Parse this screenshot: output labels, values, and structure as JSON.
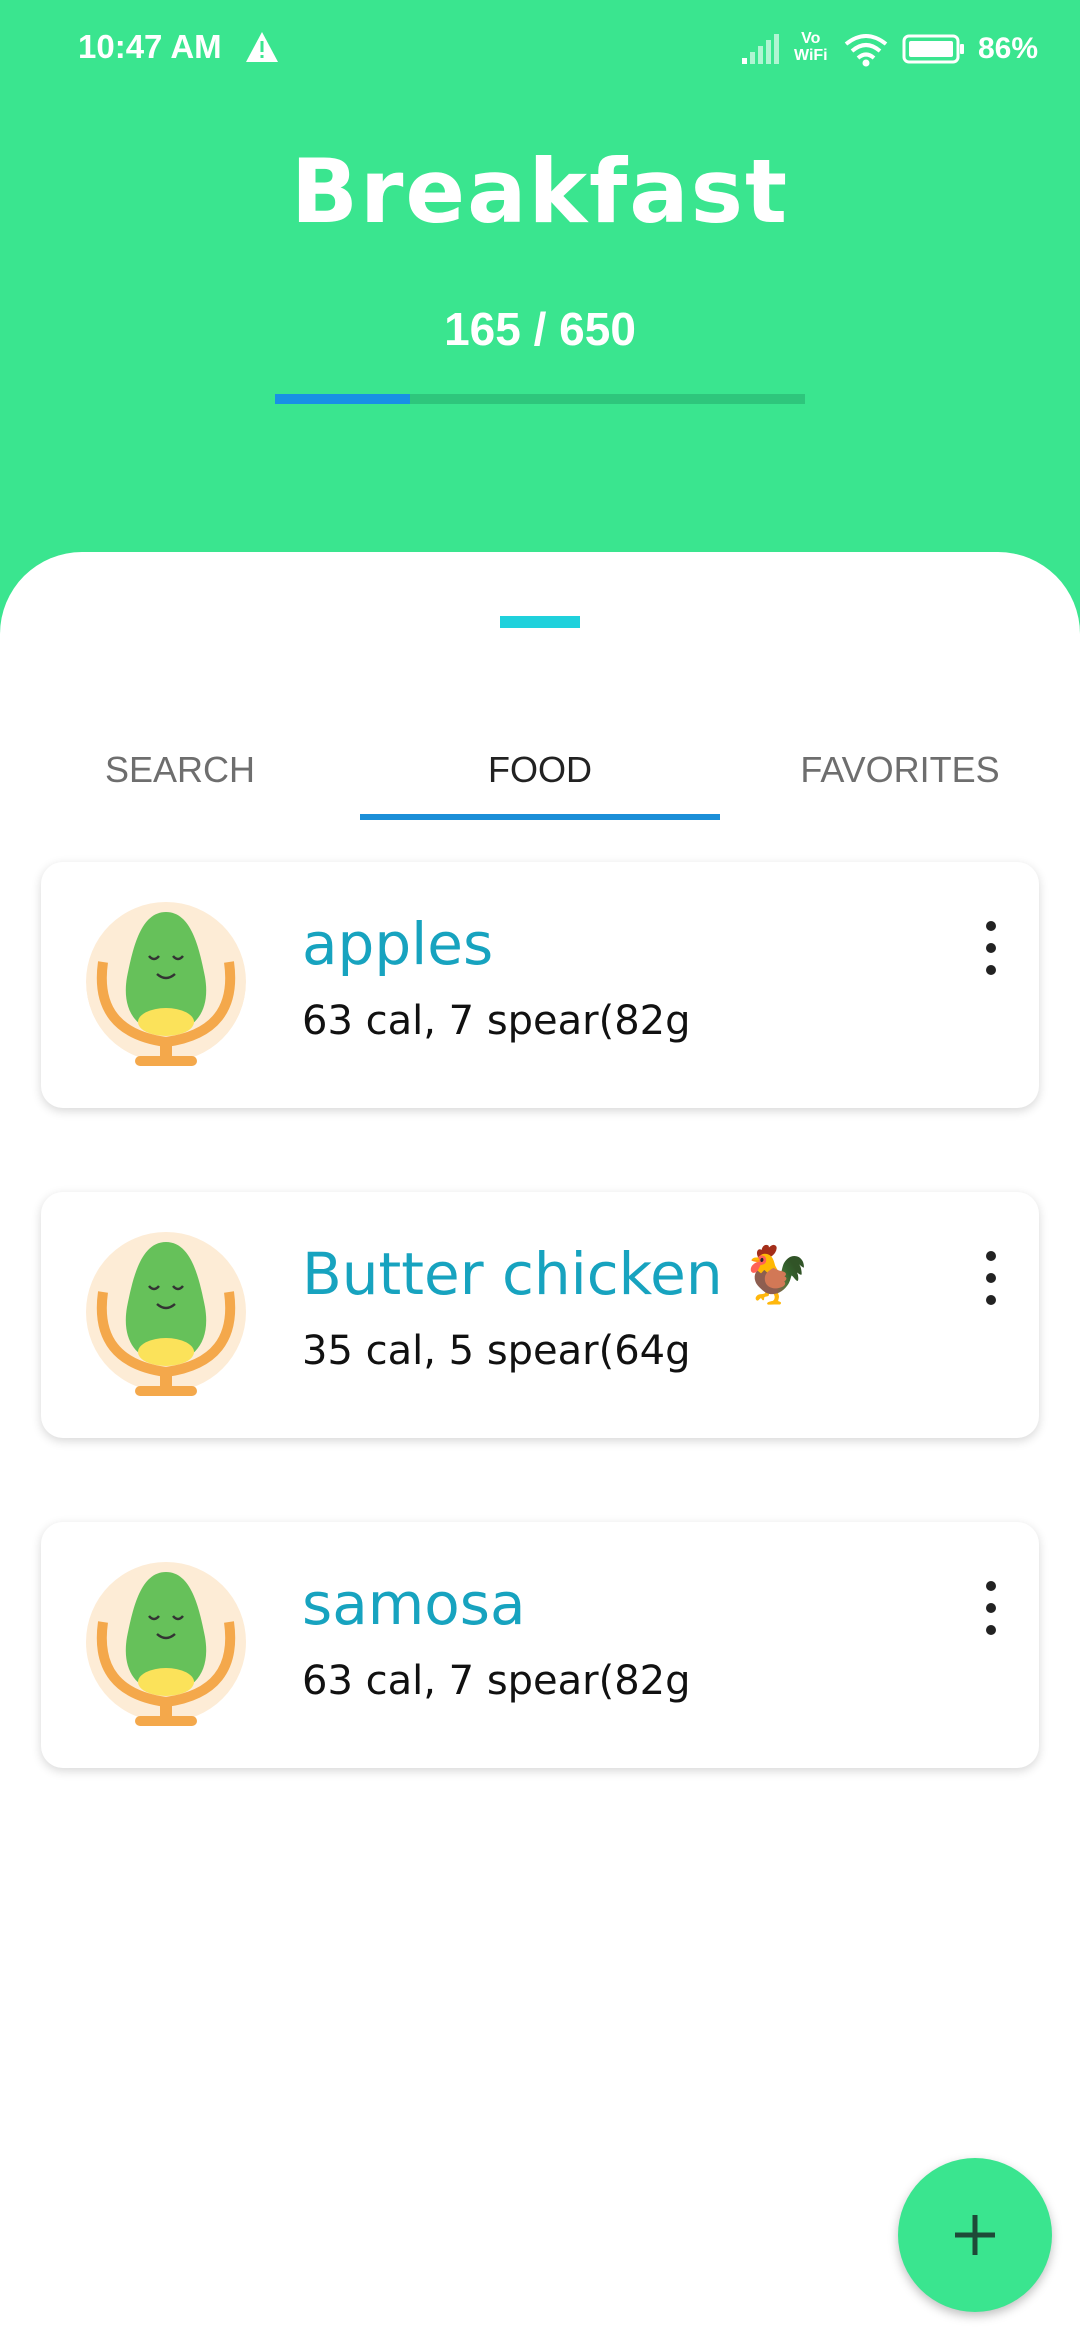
{
  "status_bar": {
    "time": "10:47 AM",
    "vowifi_top": "Vo",
    "vowifi_bottom": "WiFi",
    "battery": "86%",
    "icons": [
      "warning-icon",
      "signal-icon",
      "vowifi-icon",
      "wifi-icon",
      "battery-icon"
    ]
  },
  "header": {
    "title": "Breakfast",
    "progress_text": "165 / 650",
    "progress_fraction": 0.2538,
    "colors": {
      "background": "#3ae58f",
      "progress_fill": "#1891e5",
      "progress_track": "#2ec67c"
    }
  },
  "tabs": [
    {
      "label": "SEARCH",
      "active": false
    },
    {
      "label": "FOOD",
      "active": true
    },
    {
      "label": "FAVORITES",
      "active": false
    }
  ],
  "foods": [
    {
      "name": "apples",
      "detail": "63 cal, 7 spear(82g",
      "emoji": "",
      "icon": "avocado-avatar-icon"
    },
    {
      "name": "Butter chicken",
      "detail": "35 cal, 5 spear(64g",
      "emoji": "🐓",
      "icon": "avocado-avatar-icon"
    },
    {
      "name": "samosa",
      "detail": "63 cal, 7 spear(82g",
      "emoji": "",
      "icon": "avocado-avatar-icon"
    }
  ],
  "fab": {
    "icon": "plus-icon"
  },
  "accent_colors": {
    "food_name": "#17a3bf",
    "tab_indicator": "#1b8fd8",
    "drag_handle": "#1fd1dc"
  }
}
